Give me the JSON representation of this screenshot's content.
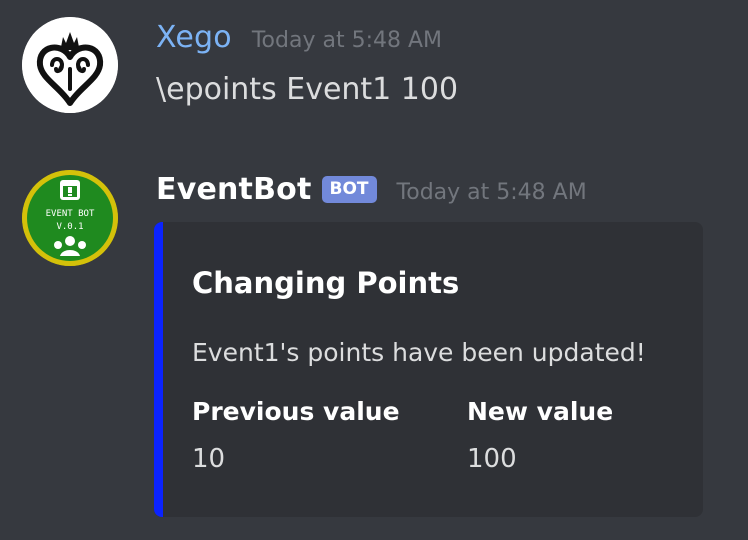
{
  "messages": [
    {
      "username": "Xego",
      "username_color": "#7cb3f5",
      "timestamp": "Today at 5:48 AM",
      "content": "\\epoints Event1 100",
      "avatar_icon": "kingdom-hearts-heart-crown-icon"
    },
    {
      "username": "EventBot",
      "username_color": "#ffffff",
      "bot_tag": "BOT",
      "timestamp": "Today at 5:48 AM",
      "avatar_icon": "event-bot-logo-icon",
      "avatar_text": [
        "EVENT BOT",
        "V.0.1"
      ],
      "embed": {
        "accent_color": "#0b23ff",
        "title": "Changing Points",
        "description": "Event1's points have been updated!",
        "fields": [
          {
            "name": "Previous value",
            "value": "10"
          },
          {
            "name": "New value",
            "value": "100"
          }
        ]
      }
    }
  ]
}
